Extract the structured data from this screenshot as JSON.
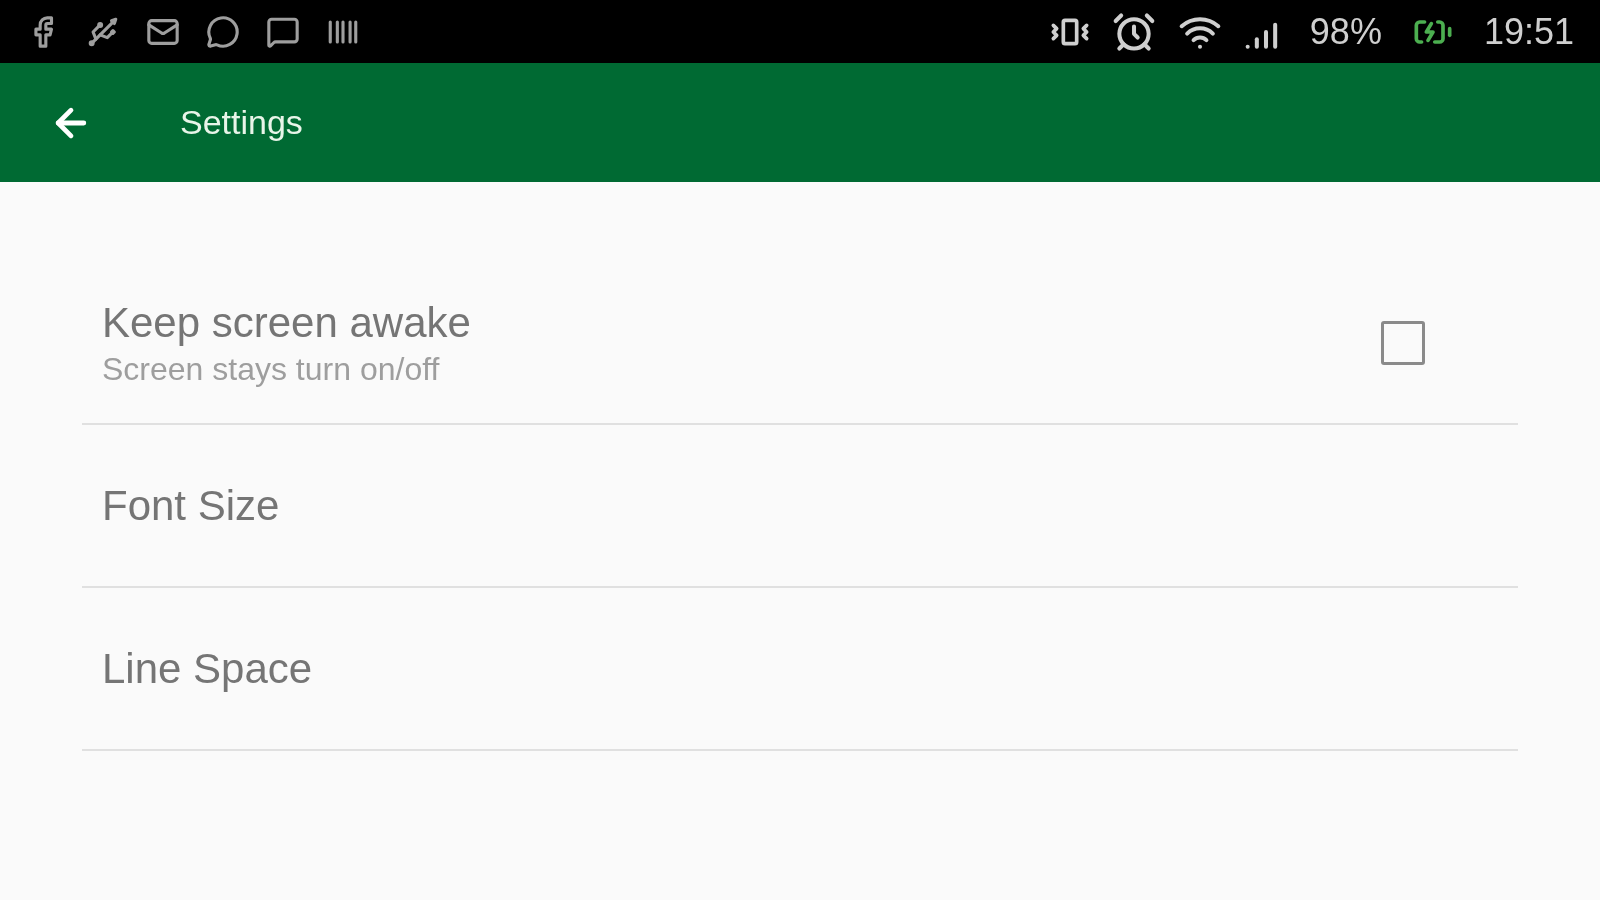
{
  "status_bar": {
    "battery": "98%",
    "time": "19:51"
  },
  "app_bar": {
    "title": "Settings"
  },
  "settings": [
    {
      "kind": "checkbox",
      "title": "Keep screen awake",
      "summary": "Screen stays turn on/off",
      "checked": false
    },
    {
      "kind": "plain",
      "title": "Font Size"
    },
    {
      "kind": "plain",
      "title": "Line Space"
    }
  ]
}
